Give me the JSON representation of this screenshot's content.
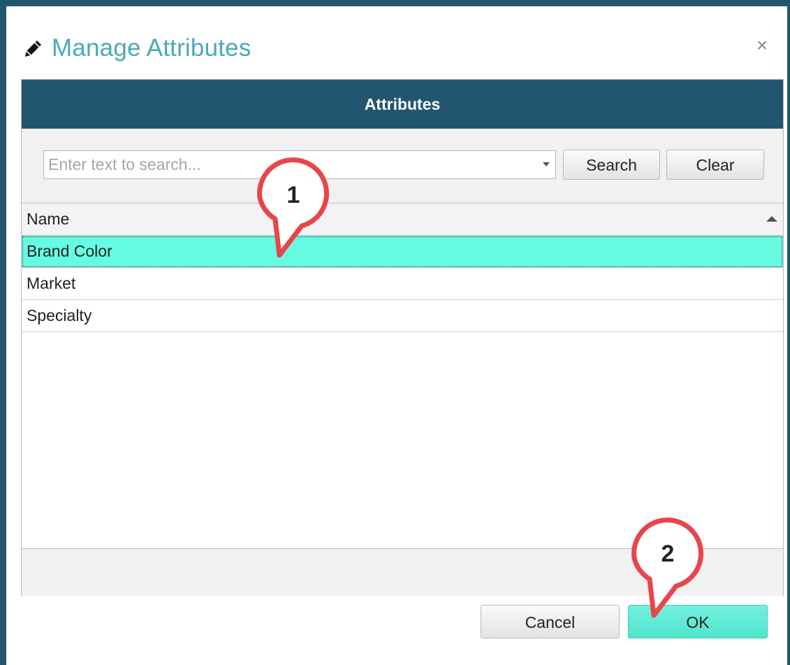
{
  "dialog": {
    "title": "Manage Attributes",
    "title_icon": "pencil-icon",
    "close_symbol": "×",
    "header": "Attributes"
  },
  "search": {
    "placeholder": "Enter text to search...",
    "value": "",
    "search_label": "Search",
    "clear_label": "Clear"
  },
  "grid": {
    "column": "Name",
    "sort": "ascending",
    "rows": [
      {
        "name": "Brand Color",
        "selected": true
      },
      {
        "name": "Market",
        "selected": false
      },
      {
        "name": "Specialty",
        "selected": false
      }
    ]
  },
  "actions": {
    "cancel_label": "Cancel",
    "ok_label": "OK"
  },
  "callouts": [
    {
      "number": "1"
    },
    {
      "number": "2"
    }
  ],
  "colors": {
    "frame": "#22566e",
    "title": "#4aaab4",
    "selected_row": "#66fce2",
    "ok_button": "#5ce9d3",
    "callout_border": "#e8454a"
  }
}
